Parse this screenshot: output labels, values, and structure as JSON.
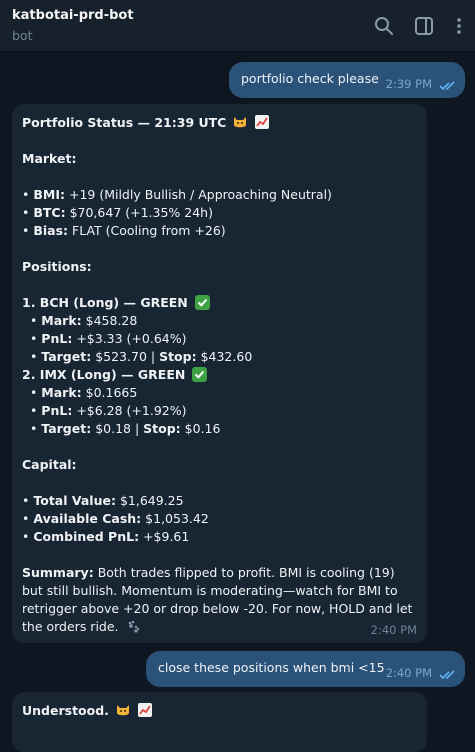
{
  "header": {
    "title": "katbotai-prd-bot",
    "subtitle": "bot"
  },
  "messages": {
    "out1": {
      "text": "portfolio check please",
      "time": "2:39 PM"
    },
    "report": {
      "heading": "Portfolio Status — 21:39 UTC",
      "market_label": "Market:",
      "bmi_label": "BMI:",
      "bmi_value": "+19 (Mildly Bullish / Approaching Neutral)",
      "btc_label": "BTC:",
      "btc_value": "$70,647 (+1.35% 24h)",
      "bias_label": "Bias:",
      "bias_value": "FLAT (Cooling from +26)",
      "positions_label": "Positions:",
      "positions": [
        {
          "title": "1. BCH (Long) — GREEN",
          "mark_label": "Mark:",
          "mark": "$458.28",
          "pnl_label": "PnL:",
          "pnl": "+$3.33 (+0.64%)",
          "target_label": "Target:",
          "target": "$523.70 |",
          "stop_label": "Stop:",
          "stop": "$432.60"
        },
        {
          "title": "2. IMX (Long) — GREEN",
          "mark_label": "Mark:",
          "mark": "$0.1665",
          "pnl_label": "PnL:",
          "pnl": "+$6.28 (+1.92%)",
          "target_label": "Target:",
          "target": "$0.18 |",
          "stop_label": "Stop:",
          "stop": "$0.16"
        }
      ],
      "capital_label": "Capital:",
      "total_label": "Total Value:",
      "total": "$1,649.25",
      "cash_label": "Available Cash:",
      "cash": "$1,053.42",
      "combined_label": "Combined PnL:",
      "combined": "+$9.61",
      "summary_label": "Summary:",
      "summary_text": "Both trades flipped to profit. BMI is cooling (19) but still bullish. Momentum is moderating—watch for BMI to retrigger above +20 or drop below -20. For now, HOLD and let the orders ride.",
      "time": "2:40 PM"
    },
    "out2": {
      "text": "close these positions when bmi <15",
      "time": "2:40 PM"
    },
    "reply": {
      "text": "Understood."
    }
  },
  "colors": {
    "background": "#0e1621",
    "incoming_bubble": "#182533",
    "outgoing_bubble": "#2b5278",
    "read_checks": "#5fb4f5",
    "green_check": "#3ea143"
  },
  "icons": [
    "search-icon",
    "sidebar-toggle-icon",
    "more-vertical-icon",
    "cat-face-emoji",
    "chart-increasing-emoji",
    "check-mark-button-emoji",
    "paw-prints-emoji",
    "double-check-icon"
  ]
}
